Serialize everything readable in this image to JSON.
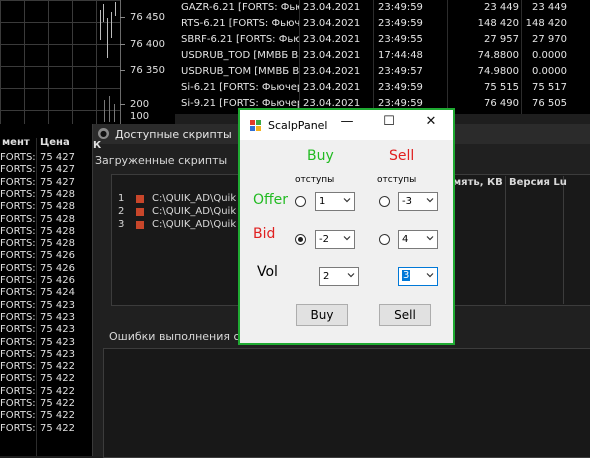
{
  "chart": {
    "prices": [
      "76 450",
      "76 400",
      "76 350",
      "200",
      "100"
    ]
  },
  "quotes": {
    "rows": [
      [
        "GAZR-6.21 [FORTS: Фьюче",
        "23.04.2021",
        "23:49:59",
        "23 449",
        "23 449"
      ],
      [
        "RTS-6.21 [FORTS: Фьюче",
        "23.04.2021",
        "23:49:59",
        "148 420",
        "148 420"
      ],
      [
        "SBRF-6.21 [FORTS: Фьюч",
        "23.04.2021",
        "23:49:55",
        "27 957",
        "27 970"
      ],
      [
        "USDRUB_TOD [ММВБ Ва",
        "23.04.2021",
        "17:44:48",
        "74.8800",
        "0.0000"
      ],
      [
        "USDRUB_TOM [ММВБ В",
        "23.04.2021",
        "23:49:57",
        "74.9800",
        "0.0000"
      ],
      [
        "Si-6.21 [FORTS: Фьючер",
        "23.04.2021",
        "23:49:59",
        "75 515",
        "75 517"
      ],
      [
        "Si-9.21 [FORTS: Фьючер",
        "23.04.2021",
        "23:49:59",
        "76 490",
        "76 505"
      ]
    ]
  },
  "trades": {
    "header": [
      "мент",
      "Цена"
    ],
    "rows": [
      [
        "FORTS:",
        "75 427"
      ],
      [
        "FORTS:",
        "75 427"
      ],
      [
        "FORTS:",
        "75 427"
      ],
      [
        "FORTS:",
        "75 428"
      ],
      [
        "FORTS:",
        "75 428"
      ],
      [
        "FORTS:",
        "75 428"
      ],
      [
        "FORTS:",
        "75 428"
      ],
      [
        "FORTS:",
        "75 428"
      ],
      [
        "FORTS:",
        "75 426"
      ],
      [
        "FORTS:",
        "75 426"
      ],
      [
        "FORTS:",
        "75 426"
      ],
      [
        "FORTS:",
        "75 424"
      ],
      [
        "FORTS:",
        "75 423"
      ],
      [
        "FORTS:",
        "75 423"
      ],
      [
        "FORTS:",
        "75 423"
      ],
      [
        "FORTS:",
        "75 423"
      ],
      [
        "FORTS:",
        "75 423"
      ],
      [
        "FORTS:",
        "75 422"
      ],
      [
        "FORTS:",
        "75 422"
      ],
      [
        "FORTS:",
        "75 422"
      ],
      [
        "FORTS:",
        "75 422"
      ],
      [
        "FORTS:",
        "75 422"
      ],
      [
        "FORTS:",
        "75 422"
      ]
    ]
  },
  "scripts_window": {
    "title": "Доступные скрипты",
    "left_header_fragment": "К",
    "loaded_group": "Загруженные скрипты",
    "columns": [
      "мять, КВ",
      "Версия Lu"
    ],
    "items": [
      {
        "num": "1",
        "path": "C:\\QUIK_AD\\Quik"
      },
      {
        "num": "2",
        "path": "C:\\QUIK_AD\\Quik"
      },
      {
        "num": "3",
        "path": "C:\\QUIK_AD\\Quik"
      }
    ],
    "errors_group": "Ошибки выполнения скр"
  },
  "scalp": {
    "title": "ScalpPanel",
    "buy_label": "Buy",
    "sell_label": "Sell",
    "buy_color": "#22bb22",
    "sell_color": "#e02020",
    "offsets_label": "отступы",
    "offer_label": "Offer",
    "bid_label": "Bid",
    "vol_label": "Vol",
    "offer_buy": "1",
    "offer_sell": "-3",
    "bid_buy": "-2",
    "bid_sell": "4",
    "vol_buy": "2",
    "vol_sell": "3",
    "buy_button": "Buy",
    "sell_button": "Sell",
    "minimize": "—",
    "maximize": "☐",
    "close": "✕"
  }
}
